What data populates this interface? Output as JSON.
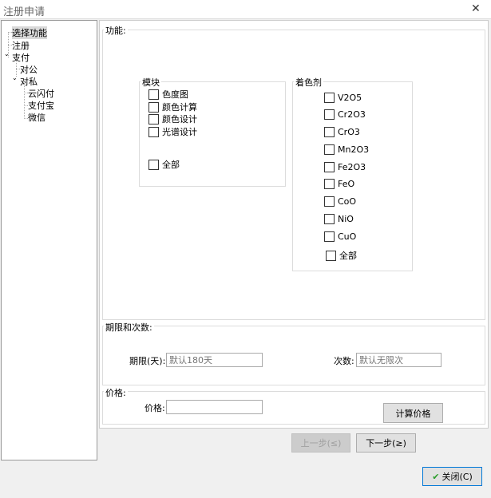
{
  "window": {
    "title": "注册申请",
    "close_label": "✕"
  },
  "tree": {
    "items": [
      {
        "label": "选择功能",
        "selected": true
      },
      {
        "label": "注册"
      },
      {
        "label": "支付",
        "expanded": true
      },
      {
        "label": "对公"
      },
      {
        "label": "对私",
        "expanded": true
      },
      {
        "label": "云闪付"
      },
      {
        "label": "支付宝"
      },
      {
        "label": "微信"
      }
    ]
  },
  "features": {
    "title": "功能:",
    "modules": {
      "title": "模块",
      "items": [
        "色度图",
        "颜色计算",
        "颜色设计",
        "光谱设计"
      ],
      "all": "全部"
    },
    "colorants": {
      "title": "着色剂",
      "items": [
        "V2O5",
        "Cr2O3",
        "CrO3",
        "Mn2O3",
        "Fe2O3",
        "FeO",
        "CoO",
        "NiO",
        "CuO"
      ],
      "all": "全部"
    }
  },
  "limits": {
    "title": "期限和次数:",
    "days_label": "期限(天):",
    "days_placeholder": "默认180天",
    "times_label": "次数:",
    "times_placeholder": "默认无限次"
  },
  "price": {
    "title": "价格:",
    "price_label": "价格:",
    "price_value": "",
    "calc_button": "计算价格"
  },
  "nav": {
    "prev": "上一步(≤)",
    "next": "下一步(≥)"
  },
  "footer": {
    "close": "关闭(C)",
    "close_icon": "check-icon",
    "check_color": "#2a9d2a"
  }
}
